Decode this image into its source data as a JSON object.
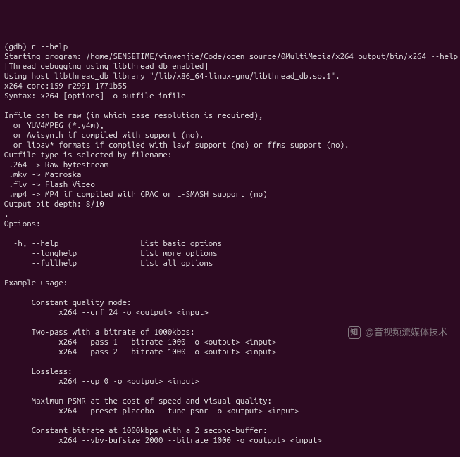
{
  "terminal": {
    "lines": [
      "(gdb) r --help",
      "Starting program: /home/SENSETIME/yinwenjie/Code/open_source/0MultiMedia/x264_output/bin/x264 --help",
      "[Thread debugging using libthread_db enabled]",
      "Using host libthread_db library \"/lib/x86_64-linux-gnu/libthread_db.so.1\".",
      "x264 core:159 r2991 1771b55",
      "Syntax: x264 [options] -o outfile infile",
      "",
      "Infile can be raw (in which case resolution is required),",
      "  or YUV4MPEG (*.y4m),",
      "  or Avisynth if compiled with support (no).",
      "  or libav* formats if compiled with lavf support (no) or ffms support (no).",
      "Outfile type is selected by filename:",
      " .264 -> Raw bytestream",
      " .mkv -> Matroska",
      " .flv -> Flash Video",
      " .mp4 -> MP4 if compiled with GPAC or L-SMASH support (no)",
      "Output bit depth: 8/10",
      ".",
      "Options:",
      "",
      "  -h, --help                  List basic options",
      "      --longhelp              List more options",
      "      --fullhelp              List all options",
      "",
      "Example usage:",
      "",
      "      Constant quality mode:",
      "            x264 --crf 24 -o <output> <input>",
      "",
      "      Two-pass with a bitrate of 1000kbps:",
      "            x264 --pass 1 --bitrate 1000 -o <output> <input>",
      "            x264 --pass 2 --bitrate 1000 -o <output> <input>",
      "",
      "      Lossless:",
      "            x264 --qp 0 -o <output> <input>",
      "",
      "      Maximum PSNR at the cost of speed and visual quality:",
      "            x264 --preset placebo --tune psnr -o <output> <input>",
      "",
      "      Constant bitrate at 1000kbps with a 2 second-buffer:",
      "            x264 --vbv-bufsize 2000 --bitrate 1000 -o <output> <input>"
    ]
  },
  "watermark": {
    "brand": "知",
    "text": "@音视频流媒体技术"
  }
}
